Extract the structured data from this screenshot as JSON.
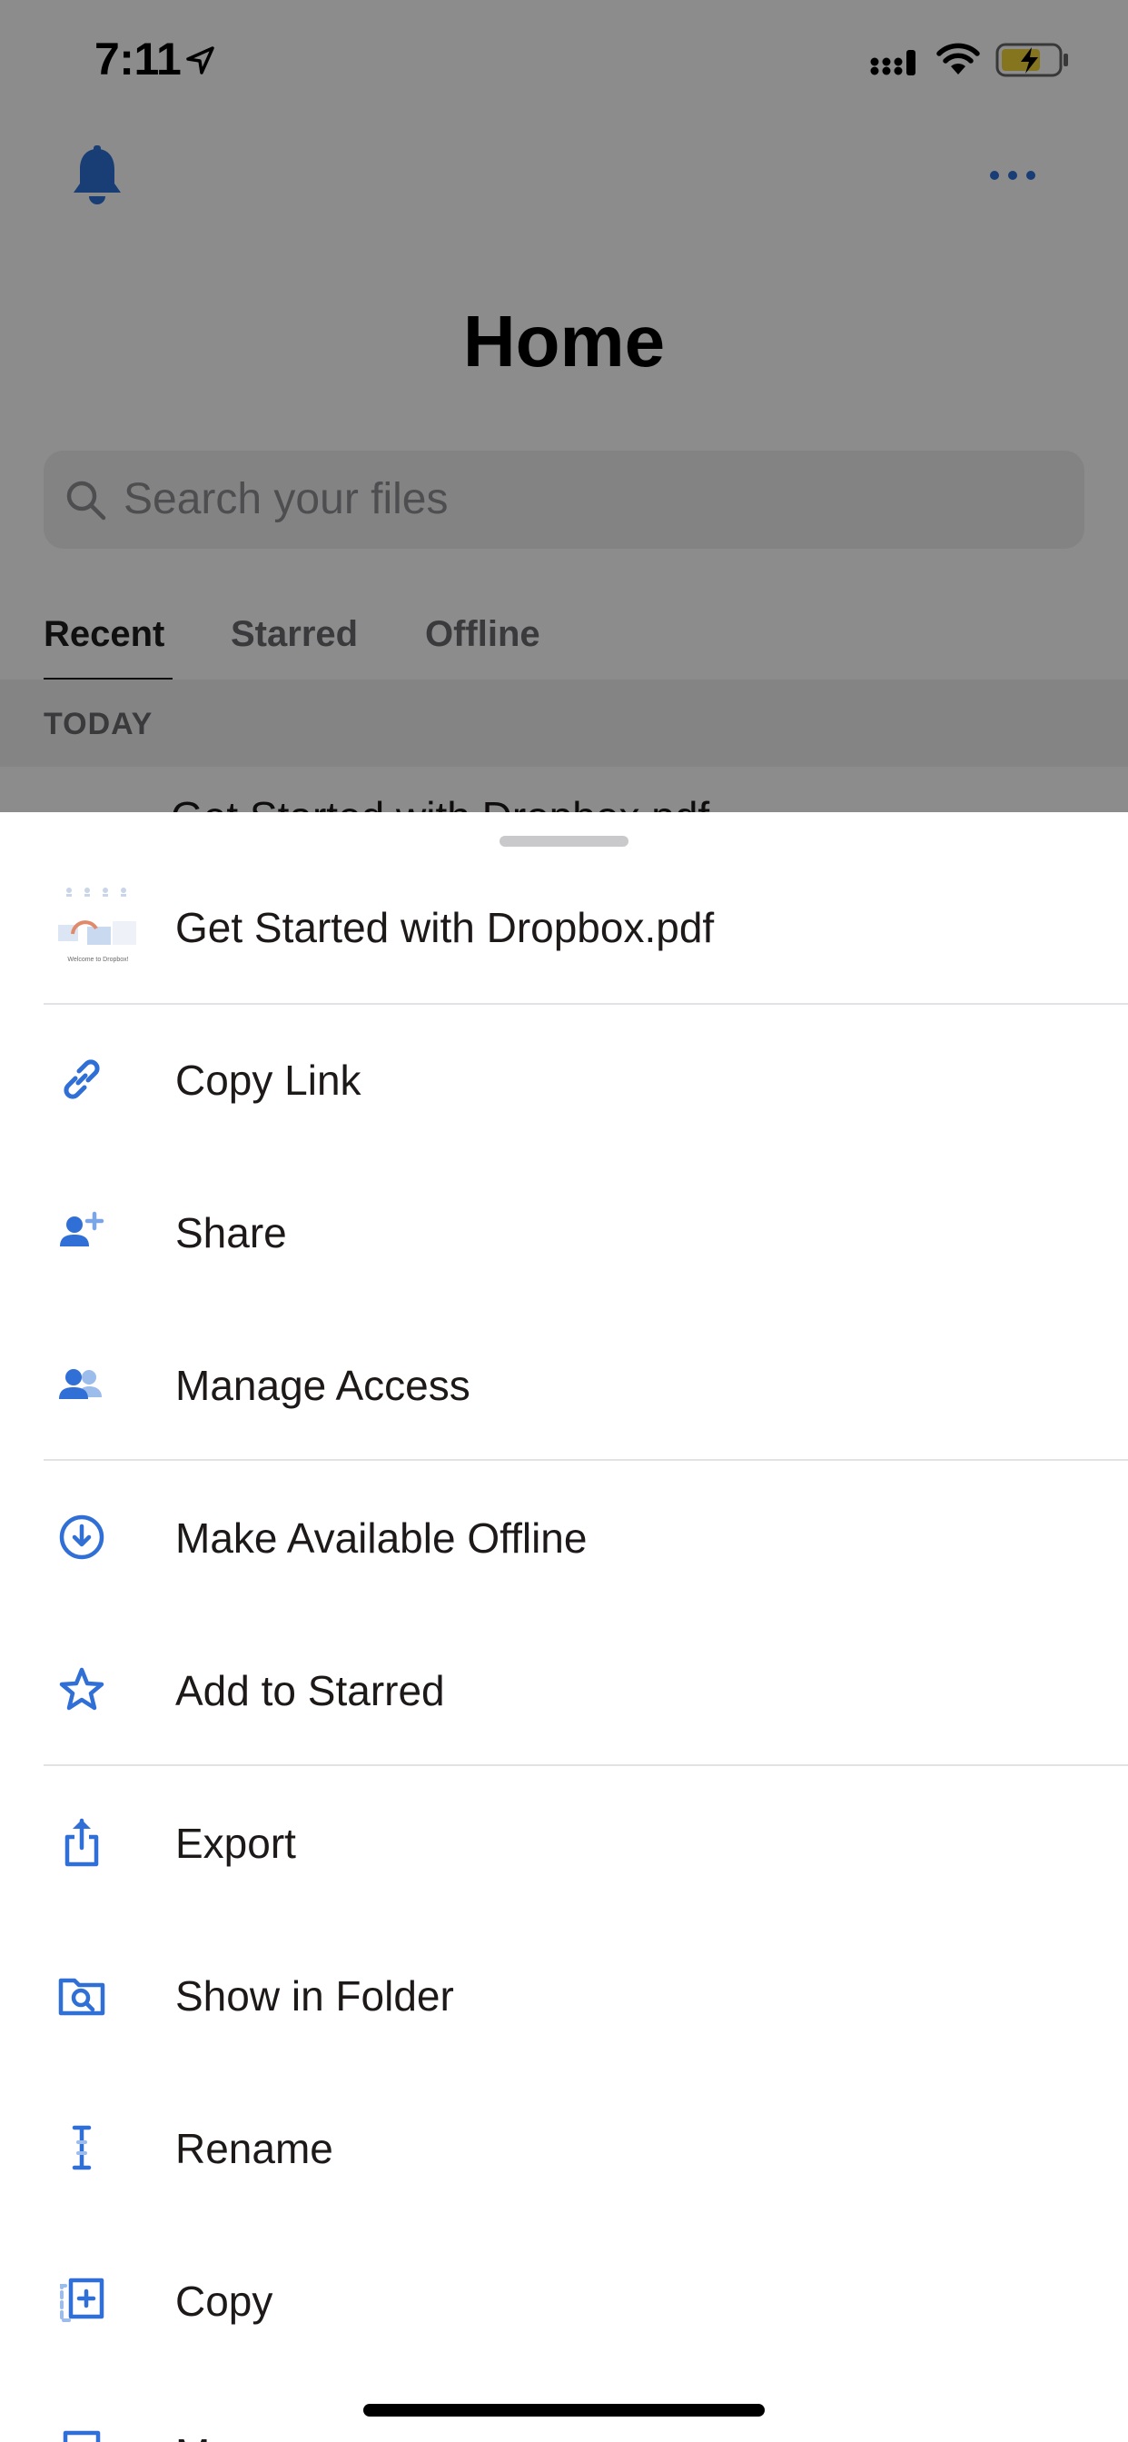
{
  "status_bar": {
    "time": "7:11"
  },
  "home": {
    "title": "Home",
    "search_placeholder": "Search your files",
    "tabs": [
      {
        "label": "Recent",
        "active": true
      },
      {
        "label": "Starred",
        "active": false
      },
      {
        "label": "Offline",
        "active": false
      }
    ],
    "section_label": "TODAY",
    "peek_row": "Get Started with Dropbox.pdf"
  },
  "sheet": {
    "file_name": "Get Started with Dropbox.pdf",
    "thumb_caption": "Welcome to Dropbox!",
    "menu": [
      {
        "label": "Copy Link",
        "icon": "link-icon"
      },
      {
        "label": "Share",
        "icon": "add-person-icon"
      },
      {
        "label": "Manage Access",
        "icon": "people-icon"
      },
      {
        "label": "Make Available Offline",
        "icon": "offline-download-icon"
      },
      {
        "label": "Add to Starred",
        "icon": "star-icon"
      },
      {
        "label": "Export",
        "icon": "export-icon"
      },
      {
        "label": "Show in Folder",
        "icon": "folder-search-icon"
      },
      {
        "label": "Rename",
        "icon": "text-cursor-icon"
      },
      {
        "label": "Copy",
        "icon": "copy-icon"
      },
      {
        "label": "Move",
        "icon": "move-icon"
      }
    ]
  },
  "colors": {
    "accent": "#2f6fd6",
    "text": "#1e1919",
    "divider": "#e3e3e6",
    "battery_charging": "#f5d53a"
  }
}
